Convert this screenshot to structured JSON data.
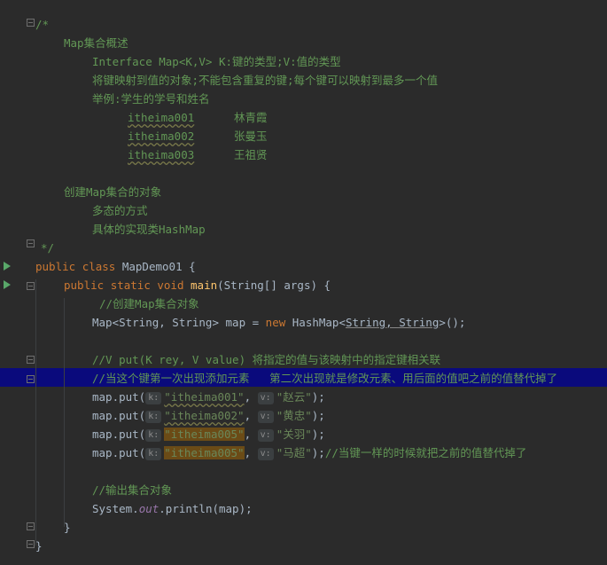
{
  "lines": {
    "l1": "/*",
    "l2": "Map集合概述",
    "l3": "Interface Map<K,V> K:键的类型;V:值的类型",
    "l4": "将键映射到值的对象;不能包含重复的键;每个键可以映射到最多一个值",
    "l5": "举例:学生的学号和姓名",
    "r1": {
      "id": "itheima001",
      "name": "林青霞"
    },
    "r2": {
      "id": "itheima002",
      "name": "张曼玉"
    },
    "r3": {
      "id": "itheima003",
      "name": "王祖贤"
    },
    "l9": "创建Map集合的对象",
    "l10": "多态的方式",
    "l11": "具体的实现类HashMap",
    "l12": "*/",
    "class_kw1": "public",
    "class_kw2": "class",
    "class_name": "MapDemo01 {",
    "main_kw1": "public",
    "main_kw2": "static",
    "main_kw3": "void",
    "main_fn": "main",
    "main_rest": "(String[] args) {",
    "c1": "//创建Map集合对象",
    "decl_a": "Map<String, String> map = ",
    "decl_new": "new",
    "decl_b": " HashMap<",
    "decl_c": "String, String",
    "decl_d": ">();",
    "c2": "//V put(K rey, V value) 将指定的值与该映射中的指定键相关联",
    "c3": "//当这个键第一次出现添加元素   第二次出现就是修改元素、用后面的值吧之前的值替代掉了",
    "hint_k": "k:",
    "hint_v": "v:",
    "put_prefix": "map.put(",
    "put_end": ");",
    "puts": [
      {
        "key": "\"itheima001\"",
        "val": "\"赵云\""
      },
      {
        "key": "\"itheima002\"",
        "val": "\"黄忠\""
      },
      {
        "key": "\"itheima005\"",
        "val": "\"关羽\""
      },
      {
        "key": "\"itheima005\"",
        "val": "\"马超\""
      }
    ],
    "c4": "//当键一样的时候就把之前的值替代掉了",
    "c5": "//输出集合对象",
    "print_a": "System.",
    "print_out": "out",
    "print_b": ".println(map);",
    "close1": "}",
    "close2": "}"
  }
}
